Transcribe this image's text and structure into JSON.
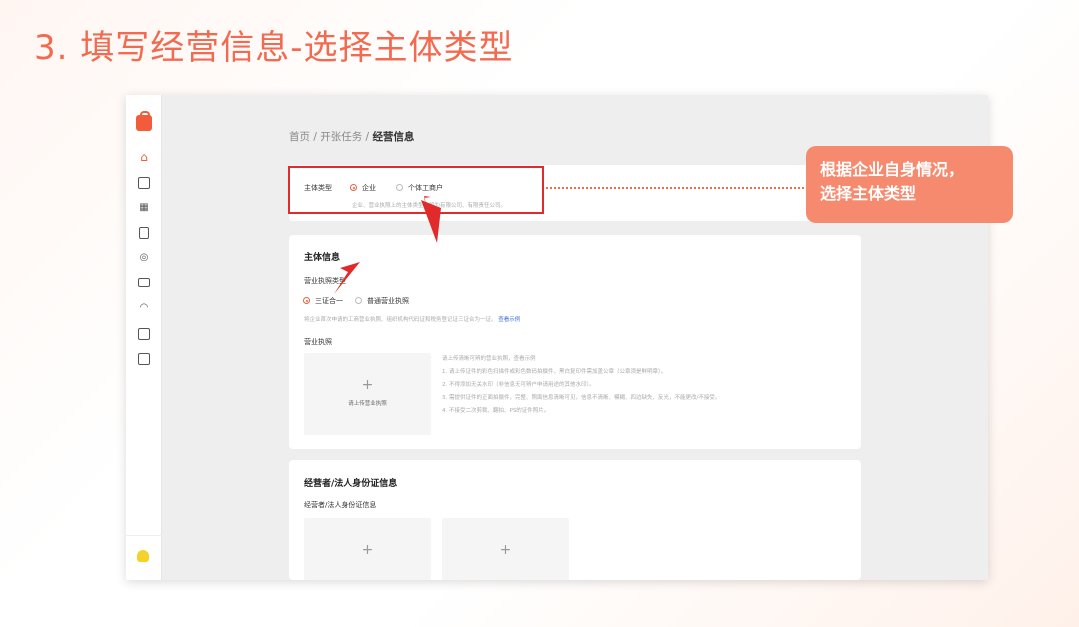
{
  "slide": {
    "title": "3. 填写经营信息-选择主体类型"
  },
  "callout": {
    "line1": "根据企业自身情况，",
    "line2": "选择主体类型"
  },
  "breadcrumb": {
    "home": "首页",
    "sep1": " / ",
    "task": "开张任务",
    "sep2": " / ",
    "current": "经营信息"
  },
  "subject_type": {
    "label": "主体类型",
    "options": [
      {
        "label": "企业",
        "selected": true
      },
      {
        "label": "个体工商户",
        "selected": false
      }
    ],
    "hint": "企业、营业执照上的主体类型一般为有限公司、有限责任公司。"
  },
  "subject_info": {
    "title": "主体信息",
    "license_type_label": "营业执照类型",
    "license_options": [
      {
        "label": "三证合一",
        "selected": true
      },
      {
        "label": "普通营业执照",
        "selected": false
      }
    ],
    "license_hint": "将企业首次申请的工商营业执照、组织机构代码证和税务登记证三证合为一证。",
    "license_hint_link": "查看示例",
    "license_label": "营业执照",
    "upload_label": "请上传营业执照",
    "upload_plus": "+",
    "rules_title": "请上传清晰可辨的营业执照，查看示例",
    "rules": [
      "1. 请上传证件的彩色扫描件或彩色数码拍摄件，黑白复印件需加盖公章（公章须是鲜明章）。",
      "2. 不得添加无关水印（非信息无可辨户申请用途的其他水印）。",
      "3. 需提供证件的正面拍摄件，完整、照面信息清晰可见，信息不清晰、模糊、四边缺失、反光，不能更改/不接受。",
      "4. 不接受二次剪裁、翻拍、PS的证件照片。"
    ]
  },
  "legal_person": {
    "title": "经营者/法人身份证信息",
    "sub_label": "经营者/法人身份证信息",
    "upload_plus": "+"
  },
  "colors": {
    "accent": "#f25c3a",
    "highlight": "#e12a2a",
    "callout_bg": "#f58a6e",
    "title": "#f26a4f"
  },
  "icons": [
    "shop-logo-icon",
    "home-icon",
    "inbox-icon",
    "grid-icon",
    "document-icon",
    "location-icon",
    "video-icon",
    "headset-icon",
    "coupon-icon",
    "image-icon",
    "bell-icon"
  ]
}
